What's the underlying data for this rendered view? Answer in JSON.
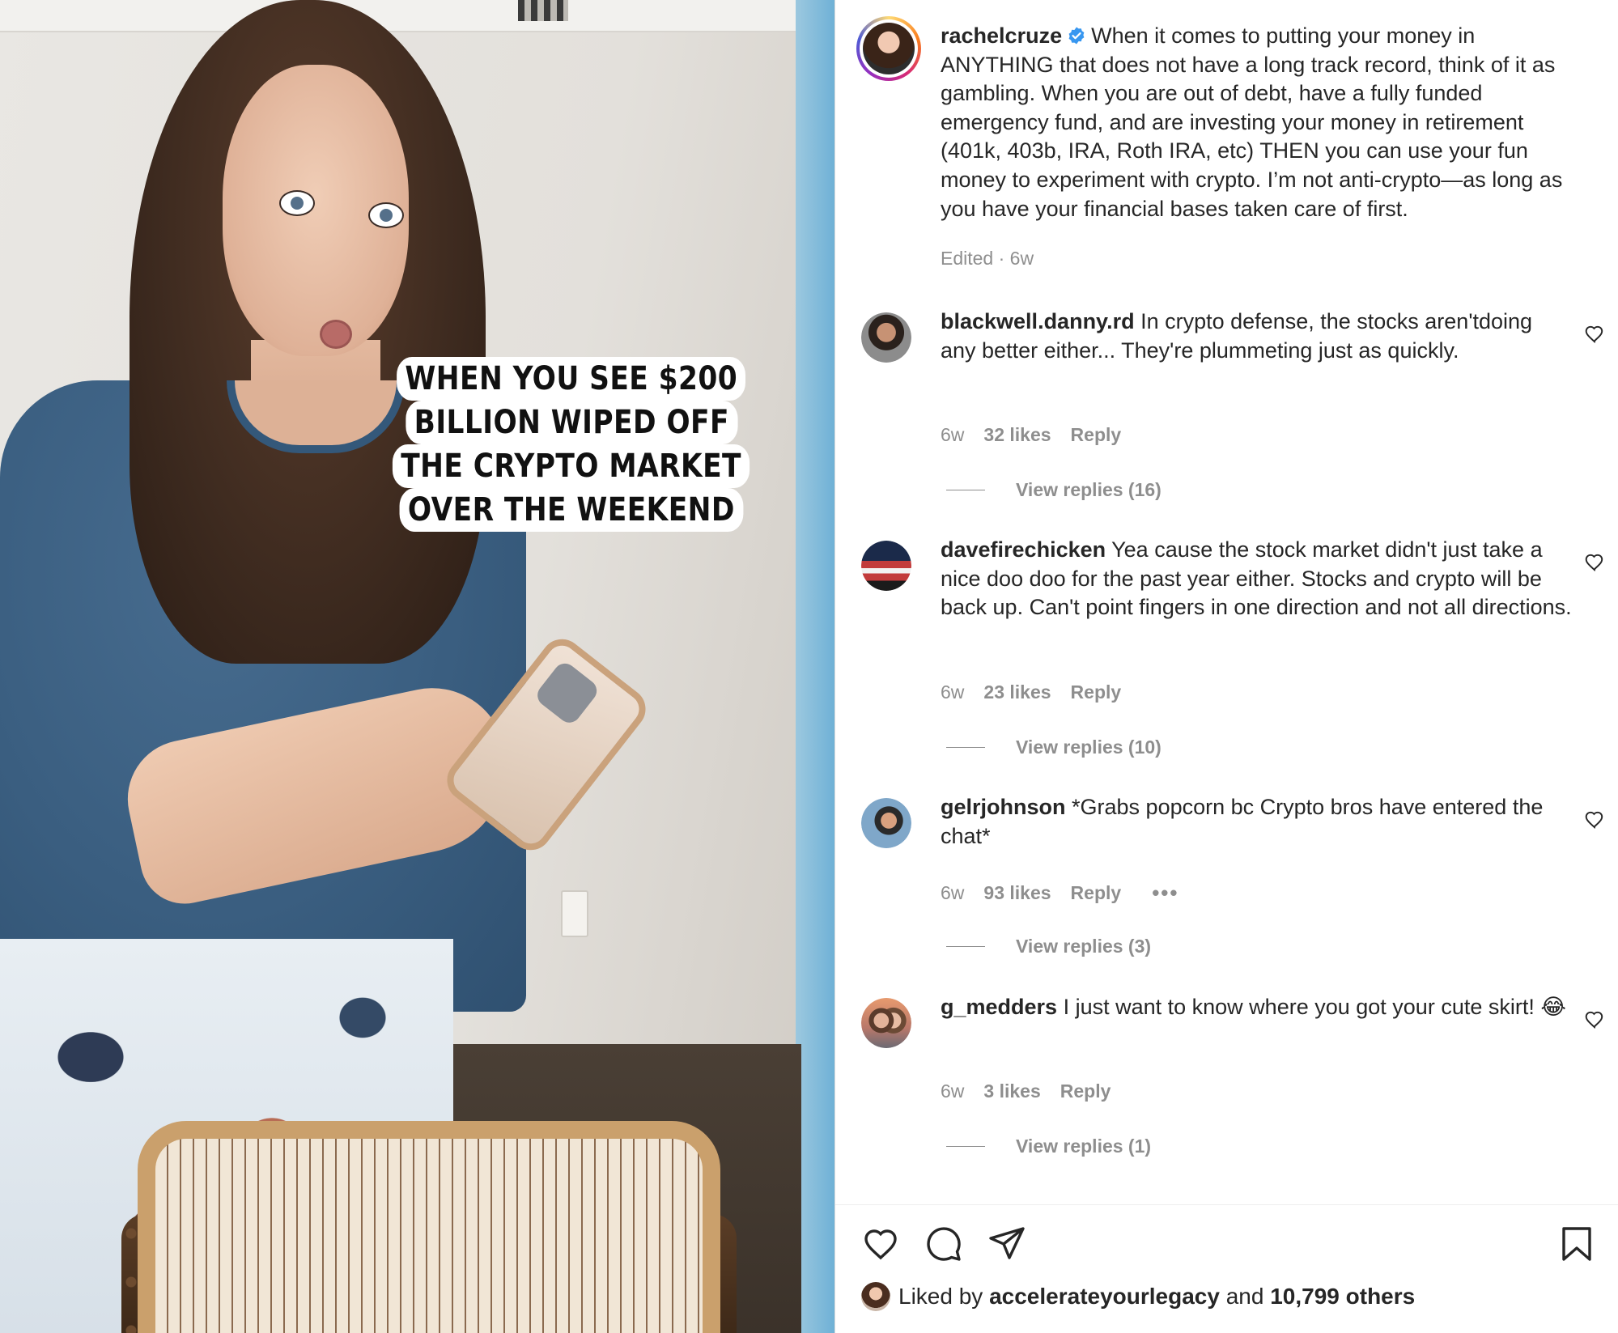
{
  "post": {
    "media": {
      "caption_lines": [
        "WHEN YOU SEE $200",
        "BILLION WIPED OFF",
        "THE CRYPTO MARKET",
        "OVER THE WEEKEND"
      ]
    },
    "author": {
      "username": "rachelcruze",
      "verified": true,
      "caption": "When it comes to putting your money in ANYTHING that does not have a long track record, think of it as gambling. When you are out of debt, have a fully funded emergency fund, and are investing your money in retirement (401k, 403b, IRA, Roth IRA, etc) THEN you can use your fun money to experiment with crypto. I’m not anti-crypto—as long as you have your financial bases taken care of first.",
      "edited_label": "Edited · 6w"
    },
    "comments": [
      {
        "username": "blackwell.danny.rd",
        "text": "In crypto defense, the stocks aren'tdoing any better either... They're plummeting just as quickly.",
        "time": "6w",
        "likes": "32 likes",
        "reply_label": "Reply",
        "view_replies": "View replies (16)"
      },
      {
        "username": "davefirechicken",
        "text": "Yea cause the stock market didn't just take a nice doo doo for the past year either. Stocks and crypto will be back up. Can't point fingers in one direction and not all directions.",
        "time": "6w",
        "likes": "23 likes",
        "reply_label": "Reply",
        "view_replies": "View replies (10)"
      },
      {
        "username": "gelrjohnson",
        "text": "*Grabs popcorn bc Crypto bros have entered the chat*",
        "time": "6w",
        "likes": "93 likes",
        "reply_label": "Reply",
        "more_label": "•••",
        "view_replies": "View replies (3)"
      },
      {
        "username": "g_medders",
        "text": "I just want to know where you got your cute skirt! 😂",
        "time": "6w",
        "likes": "3 likes",
        "reply_label": "Reply",
        "view_replies": "View replies (1)"
      }
    ],
    "actions": {
      "icons": [
        "heart-icon",
        "comment-icon",
        "share-icon",
        "bookmark-icon"
      ],
      "liked_by_prefix": "Liked by",
      "liked_by_user": "accelerateyourlegacy",
      "liked_by_and": "and",
      "liked_by_others": "10,799 others"
    },
    "colors": {
      "verified": "#3897f0",
      "muted_text": "#8e8e8e",
      "primary_text": "#262626"
    }
  }
}
